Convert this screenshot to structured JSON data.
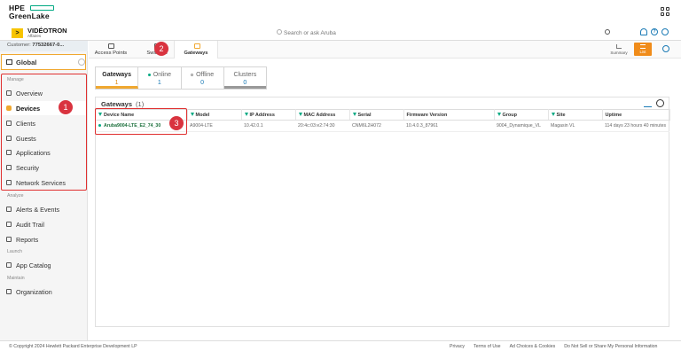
{
  "topbar": {
    "logo_line1": "HPE",
    "logo_line2": "GreenLake"
  },
  "header": {
    "brand_name": "VIDÉOTRON",
    "brand_sub": "Affaires",
    "brand_mark": ">",
    "search_placeholder": "Search or ask Aruba"
  },
  "sidebar": {
    "customer_label": "Customer:",
    "customer_value": "77532667-0...",
    "global_label": "Global",
    "sections": {
      "manage": "Manage",
      "analyze": "Analyze",
      "launch": "Launch",
      "maintain": "Maintain"
    },
    "items": [
      {
        "label": "Overview",
        "icon": "overview-icon"
      },
      {
        "label": "Devices",
        "icon": "devices-icon",
        "active": true
      },
      {
        "label": "Clients",
        "icon": "clients-icon"
      },
      {
        "label": "Guests",
        "icon": "guests-icon"
      },
      {
        "label": "Applications",
        "icon": "applications-icon"
      },
      {
        "label": "Security",
        "icon": "security-icon"
      },
      {
        "label": "Network Services",
        "icon": "network-services-icon"
      },
      {
        "label": "Alerts & Events",
        "icon": "alerts-icon"
      },
      {
        "label": "Audit Trail",
        "icon": "audit-trail-icon"
      },
      {
        "label": "Reports",
        "icon": "reports-icon"
      },
      {
        "label": "App Catalog",
        "icon": "app-catalog-icon"
      },
      {
        "label": "Organization",
        "icon": "organization-icon"
      }
    ]
  },
  "device_tabs": [
    {
      "label": "Access Points"
    },
    {
      "label": "Switches"
    },
    {
      "label": "Gateways",
      "active": true
    }
  ],
  "view_buttons": {
    "summary": "Summary",
    "list": "List"
  },
  "status_tabs": [
    {
      "label": "Gateways",
      "value": "1"
    },
    {
      "label": "Online",
      "value": "1"
    },
    {
      "label": "Offline",
      "value": "0"
    },
    {
      "label": "Clusters",
      "value": "0"
    }
  ],
  "panel": {
    "title": "Gateways",
    "count": "(1)",
    "columns": [
      "Device Name",
      "Model",
      "IP Address",
      "MAC Address",
      "Serial",
      "Firmware Version",
      "Group",
      "Site",
      "Uptime"
    ],
    "rows": [
      [
        "Aruba9004-LTE_E2_74_30",
        "A9004-LTE",
        "10.42.0.1",
        "20:4c:03:e2:74:30",
        "CNM6L2H072",
        "10.4.0.3_87961",
        "9004_Dynamique_VL",
        "Magasin VL",
        "114 days 23 hours 40 minutes"
      ]
    ]
  },
  "annotations": {
    "badge1": "1",
    "badge2": "2",
    "badge3": "3"
  },
  "footer": {
    "copyright": "© Copyright 2024 Hewlett Packard Enterprise Development LP",
    "links": [
      "Privacy",
      "Terms of Use",
      "Ad Choices & Cookies",
      "Do Not Sell or Share My Personal Information"
    ]
  },
  "colors": {
    "accent": "#f0a830",
    "brand": "#01a982",
    "annotation": "#e03030",
    "link": "#1a7ab5"
  }
}
